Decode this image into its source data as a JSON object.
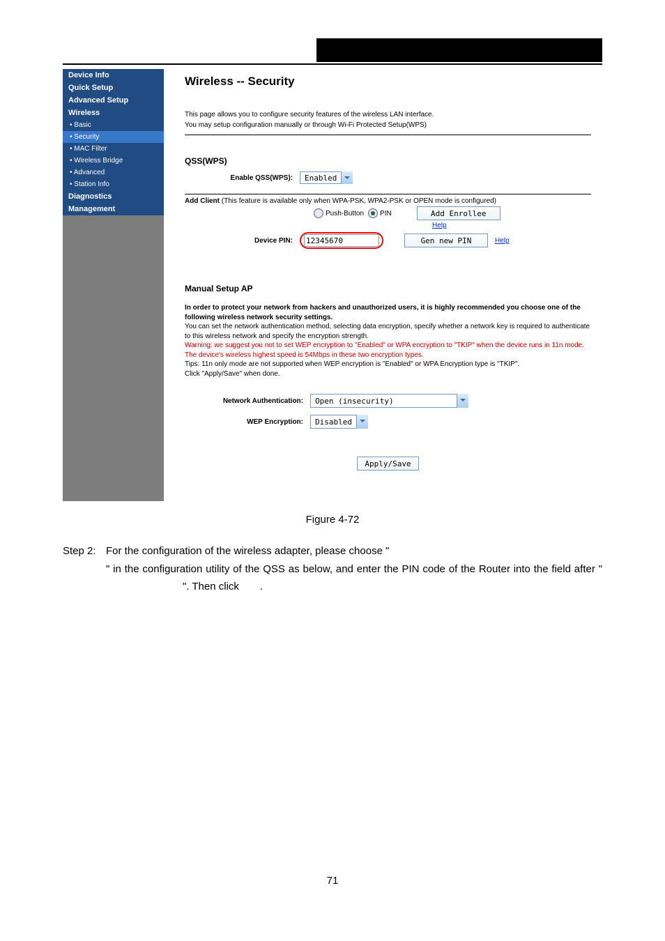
{
  "header_blackbar": true,
  "nav": {
    "items": [
      {
        "label": "Device Info",
        "type": "top"
      },
      {
        "label": "Quick Setup",
        "type": "top"
      },
      {
        "label": "Advanced Setup",
        "type": "top"
      },
      {
        "label": "Wireless",
        "type": "top"
      },
      {
        "label": "• Basic",
        "type": "sub"
      },
      {
        "label": "• Security",
        "type": "sub",
        "sel": true
      },
      {
        "label": "• MAC Filter",
        "type": "sub"
      },
      {
        "label": "• Wireless Bridge",
        "type": "sub"
      },
      {
        "label": "• Advanced",
        "type": "sub"
      },
      {
        "label": "• Station Info",
        "type": "sub"
      },
      {
        "label": "Diagnostics",
        "type": "top"
      },
      {
        "label": "Management",
        "type": "top"
      }
    ]
  },
  "content": {
    "title": "Wireless -- Security",
    "desc1": "This page allows you to configure security features of the wireless LAN interface.",
    "desc2": "You may setup configuration manually or through Wi-Fi Protected Setup(WPS)",
    "qss_head": "QSS(WPS)",
    "enable_qss_label": "Enable QSS(WPS):",
    "enable_qss_value": "Enabled",
    "add_client_label": "Add Client",
    "add_client_note": " (This feature is available only when WPA-PSK, WPA2-PSK or OPEN mode is configured)",
    "radio_push": "Push-Button",
    "radio_pin": "PIN",
    "btn_add_enrollee": "Add Enrollee",
    "help": "Help",
    "device_pin_label": "Device PIN:",
    "device_pin_value": "12345670",
    "btn_gen_pin": "Gen new PIN",
    "manual_head": "Manual Setup AP",
    "para_bold": "In order to protect your network from hackers and unauthorized users, it is highly recommended you choose one of the following wireless network security settings.",
    "para_plain1": "You can set the network authentication method, selecting data encryption, specify whether a network key is required to authenticate to this wireless network and specify the encryption strength.",
    "para_warn": "Warning: we suggest you not to set WEP encryption to \"Enabled\" or WPA encryption to \"TKIP\" when the device runs in 11n mode. The device's wireless highest speed is 54Mbps in these two encryption types.",
    "para_plain2": "Tips: 11n only mode are not supported when WEP encryption is \"Enabled\" or WPA Encryption type is \"TKIP\".",
    "para_plain3": "Click \"Apply/Save\" when done.",
    "net_auth_label": "Network Authentication:",
    "net_auth_value": "Open (insecurity)",
    "wep_label": "WEP Encryption:",
    "wep_value": "Disabled",
    "btn_apply": "Apply/Save"
  },
  "figure_caption": "Figure 4-72",
  "step": {
    "lead": "Step 2:",
    "line1a": "For  the  configuration  of  the  wireless  adapter,  please  choose  \"",
    "line1b": "\"  in the configuration utility of the QSS as below, and enter the PIN code of",
    "line2a": "the Router into the field after \"",
    "line2b": "\". Then click",
    "line2c": "."
  },
  "page_number": "71"
}
